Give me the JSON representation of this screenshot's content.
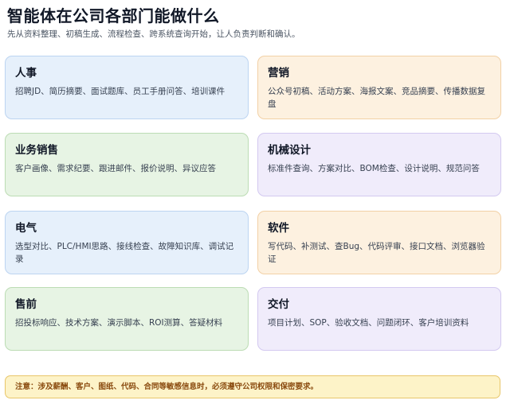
{
  "header": {
    "title": "智能体在公司各部门能做什么",
    "subtitle": "先从资料整理、初稿生成、流程检查、跨系统查询开始，让人负责判断和确认。"
  },
  "departments": [
    {
      "title": "人事",
      "desc": "招聘JD、简历摘要、面试题库、员工手册问答、培训课件",
      "color": "#e6f0fb"
    },
    {
      "title": "营销",
      "desc": "公众号初稿、活动方案、海报文案、竞品摘要、传播数据复盘",
      "color": "#fdf1e0"
    },
    {
      "title": "业务销售",
      "desc": "客户画像、需求纪要、跟进邮件、报价说明、异议应答",
      "color": "#e7f4e4"
    },
    {
      "title": "机械设计",
      "desc": "标准件查询、方案对比、BOM检查、设计说明、规范问答",
      "color": "#f0ecfb"
    },
    {
      "title": "电气",
      "desc": "选型对比、PLC/HMI思路、接线检查、故障知识库、调试记录",
      "color": "#e6f0fb"
    },
    {
      "title": "软件",
      "desc": "写代码、补测试、查Bug、代码评审、接口文档、浏览器验证",
      "color": "#fdf1e0"
    },
    {
      "title": "售前",
      "desc": "招投标响应、技术方案、演示脚本、ROI测算、答疑材料",
      "color": "#e7f4e4"
    },
    {
      "title": "交付",
      "desc": "项目计划、SOP、验收文档、问题闭环、客户培训资料",
      "color": "#f0ecfb"
    }
  ],
  "notice": {
    "text": "注意：涉及薪酬、客户、图纸、代码、合同等敏感信息时，必须遵守公司权限和保密要求。",
    "color": "#fdf3c8"
  }
}
